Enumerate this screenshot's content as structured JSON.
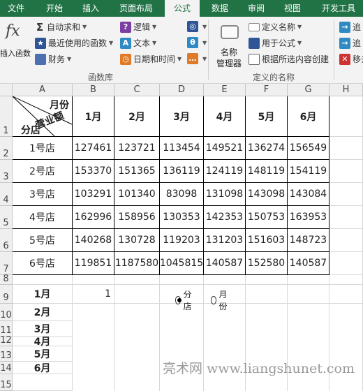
{
  "tabs": [
    "文件",
    "开始",
    "插入",
    "页面布局",
    "公式",
    "数据",
    "审阅",
    "视图",
    "开发工具"
  ],
  "active_tab": "公式",
  "ribbon": {
    "insert_function_label": "插入函数",
    "insert_function_icon": "fx",
    "library_items": [
      "自动求和",
      "最近使用的函数",
      "财务",
      "逻辑",
      "文本",
      "日期和时间"
    ],
    "library_group_label": "函数库",
    "name_manager_label1": "名称",
    "name_manager_label2": "管理器",
    "names_items": [
      "定义名称",
      "用于公式",
      "根据所选内容创建"
    ],
    "names_group_label": "定义的名称",
    "audit_items": [
      "追",
      "追",
      "移去"
    ]
  },
  "columns": [
    "A",
    "B",
    "C",
    "D",
    "E",
    "F",
    "G",
    "H"
  ],
  "rows": [
    "1",
    "2",
    "3",
    "4",
    "5",
    "6",
    "7",
    "8",
    "9",
    "10",
    "11",
    "12",
    "13",
    "14",
    "15"
  ],
  "header_diag": {
    "month": "月份",
    "sales": "营业额",
    "store": "分店"
  },
  "months": [
    "1月",
    "2月",
    "3月",
    "4月",
    "5月",
    "6月"
  ],
  "stores": [
    "1号店",
    "2号店",
    "3号店",
    "4号店",
    "5号店",
    "6号店"
  ],
  "table": [
    [
      "127461",
      "123721",
      "113454",
      "149521",
      "136274",
      "156549"
    ],
    [
      "153370",
      "151365",
      "136119",
      "124119",
      "148119",
      "154119"
    ],
    [
      "103291",
      "101340",
      "83098",
      "131098",
      "143098",
      "143084"
    ],
    [
      "162996",
      "158956",
      "130353",
      "142353",
      "150753",
      "163953"
    ],
    [
      "140268",
      "130728",
      "119203",
      "131203",
      "151603",
      "148723"
    ],
    [
      "119851",
      "1187580",
      "1045815",
      "140587",
      "152580",
      "140587"
    ]
  ],
  "list_months": [
    "1月",
    "2月",
    "3月",
    "4月",
    "5月",
    "6月"
  ],
  "b9_value": "1",
  "radio": {
    "store_label": "分店",
    "month_label": "月份",
    "selected": "store"
  },
  "watermark": "亮术网 www.liangshunet.com"
}
